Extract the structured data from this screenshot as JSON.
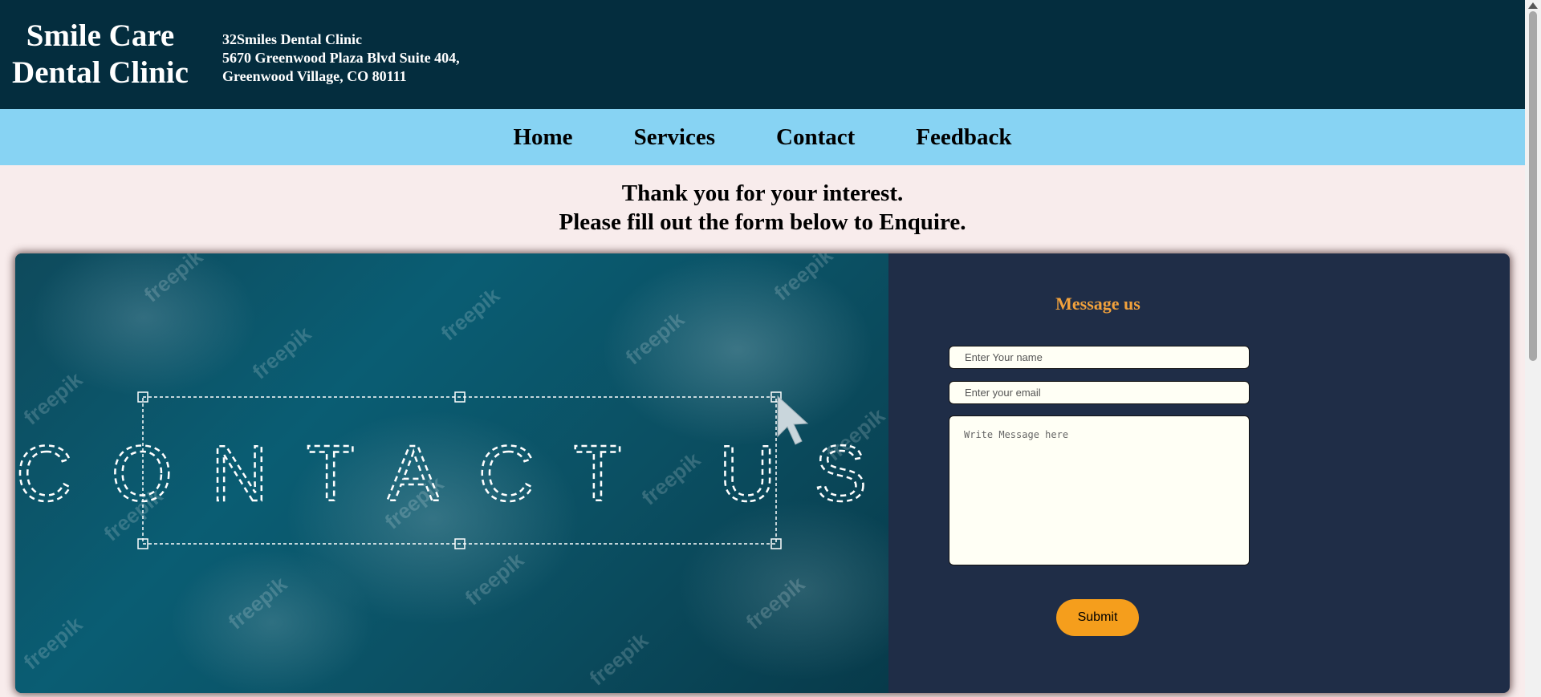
{
  "header": {
    "brand_line1": "Smile Care",
    "brand_line2": "Dental Clinic",
    "address_line1": "32Smiles Dental Clinic",
    "address_line2": "5670 Greenwood Plaza Blvd Suite 404,",
    "address_line3": "Greenwood Village, CO 80111"
  },
  "nav": {
    "items": [
      {
        "label": "Home"
      },
      {
        "label": "Services"
      },
      {
        "label": "Contact"
      },
      {
        "label": "Feedback"
      }
    ]
  },
  "intro": {
    "line1": "Thank you for your interest.",
    "line2": "Please fill out the form below to Enquire."
  },
  "banner": {
    "text": "CONTACT US",
    "watermark": "freepik"
  },
  "form": {
    "title": "Message us",
    "name_placeholder": "Enter Your name",
    "email_placeholder": "Enter your email",
    "message_placeholder": "Write Message here",
    "submit_label": "Submit"
  },
  "colors": {
    "header_bg": "#042d3e",
    "nav_bg": "#87d3f3",
    "page_bg": "#f8ecec",
    "card_bg": "#1f2d47",
    "accent": "#f59e1c",
    "title_accent": "#f1a13c"
  }
}
